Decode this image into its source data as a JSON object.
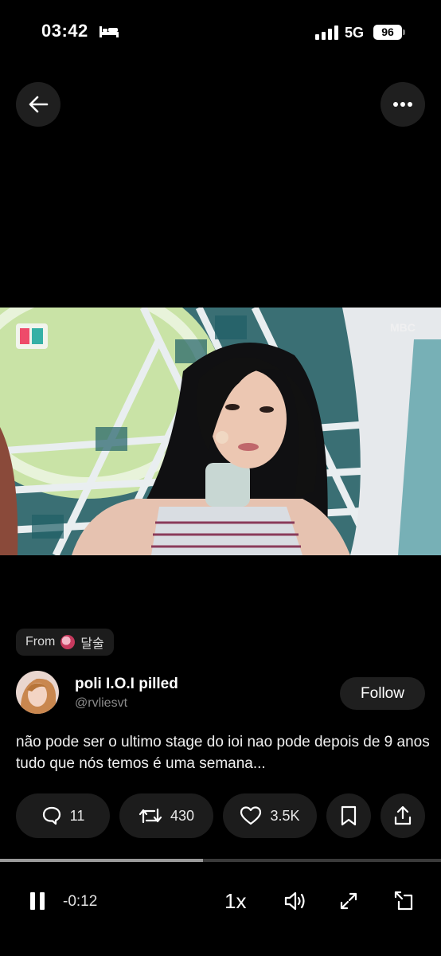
{
  "status_bar": {
    "time": "03:42",
    "network": "5G",
    "battery": "96"
  },
  "top_bar": {
    "back_icon": "arrow-left-icon",
    "more_icon": "ellipsis-icon"
  },
  "source_chip": {
    "prefix": "From",
    "name": "달술"
  },
  "author": {
    "display_name": "poli I.O.I pilled",
    "handle": "@rvliesvt",
    "follow_label": "Follow"
  },
  "tweet": {
    "text": "não pode ser o ultimo stage do ioi nao pode depois de 9 anos tudo que nós temos é uma semana..."
  },
  "actions": {
    "replies": "11",
    "retweets": "430",
    "likes": "3.5K"
  },
  "player": {
    "remaining": "-0:12",
    "speed": "1x",
    "progress_fraction": 0.46
  },
  "video": {
    "logo_text": "MBC"
  },
  "colors": {
    "background": "#000000",
    "pill": "#1c1c1c",
    "muted_text": "#8b8b8b"
  }
}
